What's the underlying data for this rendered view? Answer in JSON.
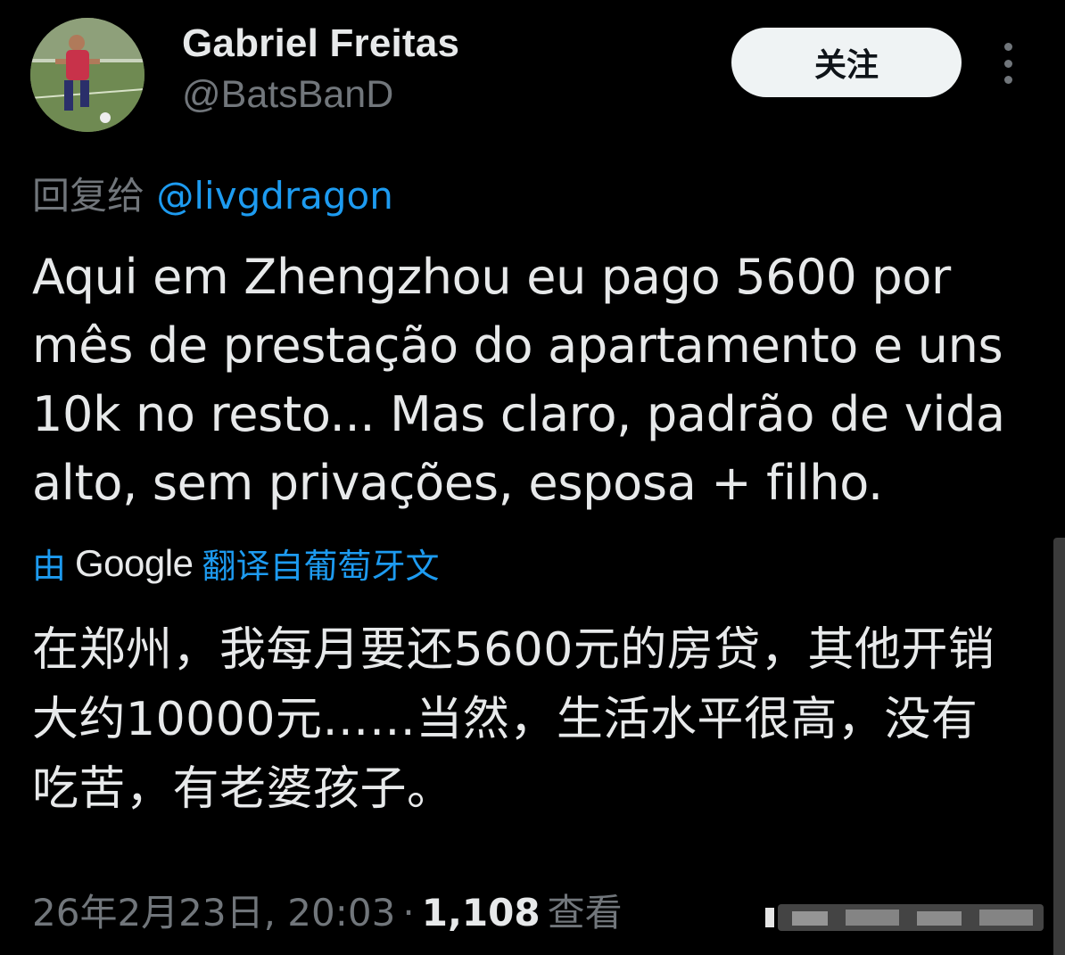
{
  "author": {
    "name": "Gabriel Freitas",
    "handle": "@BatsBanD",
    "avatar_icon": "profile-photo"
  },
  "actions": {
    "follow_label": "关注",
    "more_icon": "more-vertical-icon"
  },
  "reply": {
    "prefix": "回复给",
    "target": "@livgdragon"
  },
  "tweet": {
    "text": "Aqui em Zhengzhou eu pago 5600 por mês de prestação do apartamento e uns 10k no resto... Mas claro, padrão de vida alto, sem privações, esposa + filho."
  },
  "translation": {
    "by_label": "由",
    "provider": "Google",
    "from_label": "翻译自葡萄牙文",
    "text": "在郑州，我每月要还5600元的房贷，其他开销大约10000元……当然，生活水平很高，没有吃苦，有老婆孩子。"
  },
  "meta": {
    "timestamp": "26年2月23日, 20:03",
    "separator": "·",
    "views_count": "1,108",
    "views_label": "查看"
  },
  "colors": {
    "background": "#000000",
    "text_primary": "#e7e9ea",
    "text_secondary": "#71767b",
    "accent": "#1d9bf0",
    "button_bg": "#eff3f4"
  }
}
